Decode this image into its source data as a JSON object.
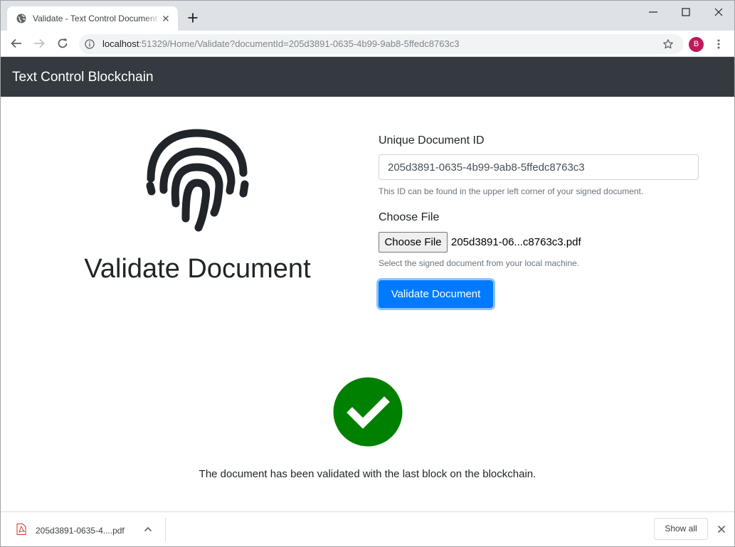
{
  "browser": {
    "tab_title": "Validate - Text Control Document",
    "url_host": "localhost",
    "url_path": ":51329/Home/Validate?documentId=205d3891-0635-4b99-9ab8-5ffedc8763c3",
    "profile_initial": "B"
  },
  "navbar": {
    "brand": "Text Control Blockchain"
  },
  "hero": {
    "heading": "Validate Document",
    "icon": "fingerprint-icon"
  },
  "form": {
    "id_label": "Unique Document ID",
    "id_value": "205d3891-0635-4b99-9ab8-5ffedc8763c3",
    "id_help": "This ID can be found in the upper left corner of your signed document.",
    "file_label": "Choose File",
    "file_button": "Choose File",
    "file_name": "205d3891-06...c8763c3.pdf",
    "file_help": "Select the signed document from your local machine.",
    "submit_label": "Validate Document"
  },
  "result": {
    "icon": "checkmark-circle-icon",
    "message": "The document has been validated with the last block on the blockchain.",
    "color": "#008000"
  },
  "downloads": {
    "file_name": "205d3891-0635-4....pdf",
    "show_all": "Show all"
  },
  "colors": {
    "navbar": "#343a40",
    "primary": "#007bff",
    "success": "#008000"
  }
}
